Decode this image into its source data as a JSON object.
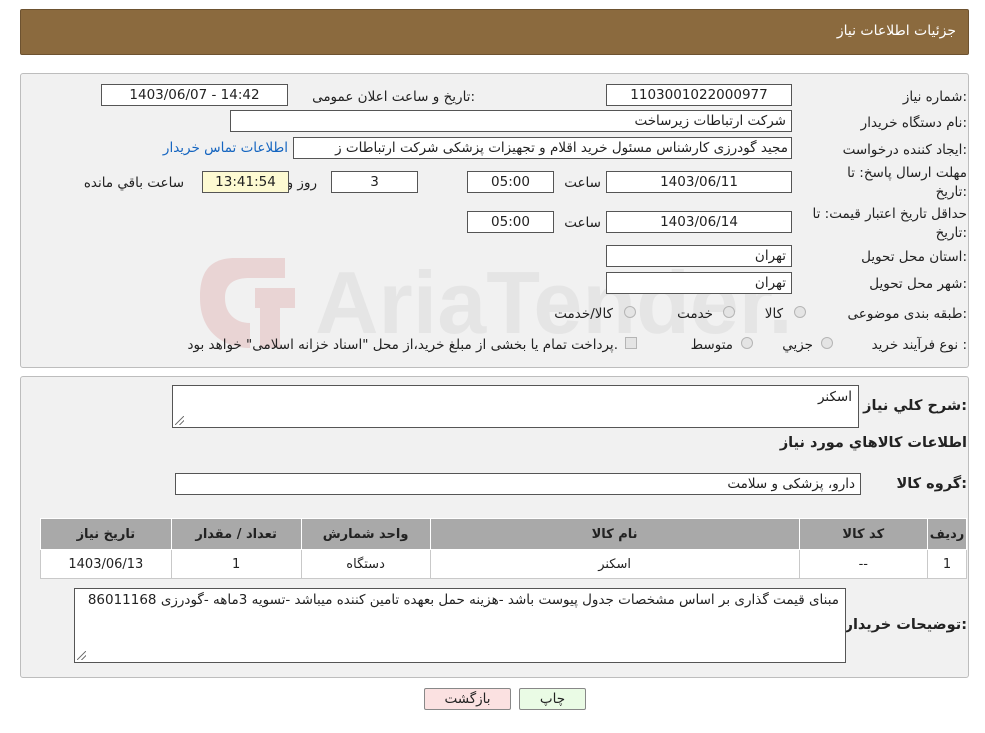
{
  "header": {
    "title": "جزئیات اطلاعات نیاز"
  },
  "fields": {
    "need_number_label": "شماره نیاز:",
    "need_number": "1103001022000977",
    "announce_label": "تاریخ و ساعت اعلان عمومی:",
    "announce_value": "1403/06/07 - 14:42",
    "buyer_org_label": "نام دستگاه خریدار:",
    "buyer_org": "شرکت ارتباطات زیرساخت",
    "creator_label": "ایجاد کننده درخواست:",
    "creator": "مجید گودرزی کارشناس مسئول خرید اقلام و تجهیزات پزشکی شرکت ارتباطات ز",
    "contact_link": "اطلاعات تماس خریدار",
    "deadline_label_1": "مهلت ارسال پاسخ: تا",
    "deadline_label_2": "تاریخ:",
    "deadline_date": "1403/06/11",
    "time_label": "ساعت",
    "deadline_time": "05:00",
    "days_value": "3",
    "days_label": "روز و",
    "remaining_time": "13:41:54",
    "remaining_label": "ساعت باقي مانده",
    "min_validity_label_1": "حداقل تاریخ اعتبار قیمت: تا",
    "min_validity_label_2": "تاریخ:",
    "validity_date": "1403/06/14",
    "validity_time": "05:00",
    "province_label": "استان محل تحویل:",
    "province": "تهران",
    "city_label": "شهر محل تحویل:",
    "city": "تهران",
    "category_label": "طبقه بندی موضوعی:",
    "category_options": [
      "کالا",
      "خدمت",
      "کالا/خدمت"
    ],
    "purchase_type_label": "نوع فرآیند خرید :",
    "purchase_options": [
      "جزیي",
      "متوسط"
    ],
    "payment_note": "پرداخت تمام یا بخشی از مبلغ خرید،از محل \"اسناد خزانه اسلامی\" خواهد بود."
  },
  "summary": {
    "general_desc_label": "شرح کلي نیاز:",
    "general_desc": "اسکنر",
    "goods_info_title": "اطلاعات کالاهاي مورد نیاز",
    "goods_group_label": "گروه کالا:",
    "goods_group": "دارو، پزشکی و سلامت"
  },
  "table": {
    "headers": [
      "ردیف",
      "کد کالا",
      "نام کالا",
      "واحد شمارش",
      "تعداد / مقدار",
      "تاریخ نیاز"
    ],
    "rows": [
      [
        "1",
        "--",
        "اسکنر",
        "دستگاه",
        "1",
        "1403/06/13"
      ]
    ]
  },
  "buyer_notes": {
    "label": "توضیحات خریدار:",
    "text": "مبنای قیمت گذاری بر اساس مشخصات جدول پیوست باشد -هزینه حمل بعهده تامین کننده میباشد -تسویه 3ماهه -گودرزی 86011168"
  },
  "buttons": {
    "print": "چاپ",
    "back": "بازگشت"
  },
  "watermark": {
    "text": "AriaTender.neT"
  },
  "colors": {
    "header": "#8b6a3e",
    "back_button": "#fbe1e1",
    "print_button": "#eafbe5",
    "link": "#1565c0"
  }
}
